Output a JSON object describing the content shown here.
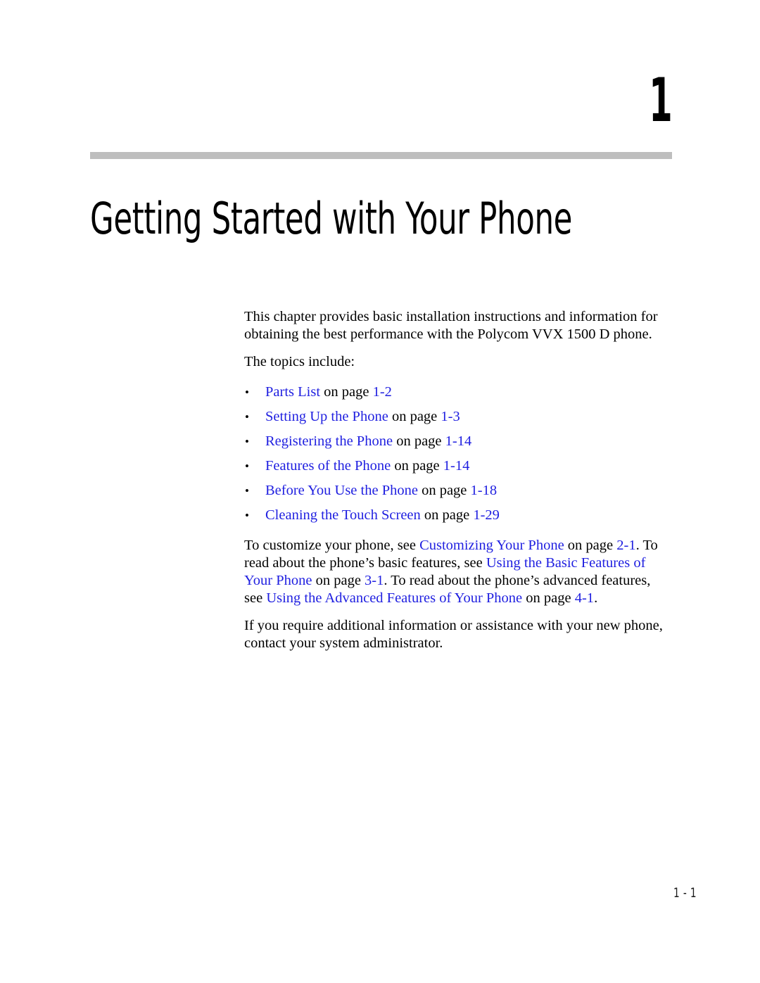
{
  "document": {
    "chapter_number": "1",
    "chapter_title": "Getting Started with Your Phone",
    "footer_page_number": "1 - 1",
    "colors": {
      "link": "#1F1FE0",
      "text": "#000000",
      "rule": "#BEBEBE",
      "background": "#FFFFFF"
    }
  },
  "intro": {
    "paragraph_1": "This chapter provides basic installation instructions and information for obtaining the best performance with the Polycom VVX 1500 D phone.",
    "paragraph_2": "The topics include:"
  },
  "topics": {
    "bullet_glyph": "•",
    "items": [
      {
        "link": "Parts List",
        "middle": " on page ",
        "page": "1-2"
      },
      {
        "link": "Setting Up the Phone",
        "middle": " on page ",
        "page": "1-3"
      },
      {
        "link": "Registering the Phone",
        "middle": " on page ",
        "page": "1-14"
      },
      {
        "link": "Features of the Phone",
        "middle": " on page ",
        "page": "1-14"
      },
      {
        "link": "Before You Use the Phone",
        "middle": " on page ",
        "page": "1-18"
      },
      {
        "link": "Cleaning the Touch Screen",
        "middle": " on page ",
        "page": "1-29"
      }
    ]
  },
  "cross_references": {
    "seg_1": "To customize your phone, see ",
    "link_1": "Customizing Your Phone",
    "seg_2": " on page ",
    "page_1": "2-1",
    "seg_3": ". To read about the phone’s basic features, see ",
    "link_2": "Using the Basic Features of Your Phone",
    "seg_4": " on page ",
    "page_2": "3-1",
    "seg_5": ". To read about the phone’s advanced features, see ",
    "link_3": "Using the Advanced Features of Your Phone",
    "seg_6": " on page ",
    "page_3": "4-1",
    "seg_7": "."
  },
  "closing": {
    "paragraph": "If you require additional information or assistance with your new phone, contact your system administrator."
  }
}
